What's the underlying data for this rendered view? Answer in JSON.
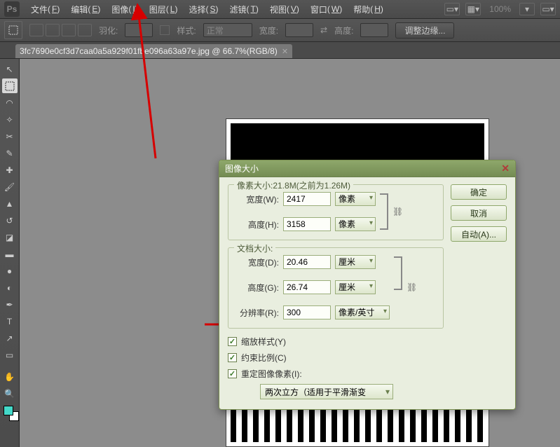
{
  "menu": {
    "items": [
      {
        "label": "文件",
        "key": "F"
      },
      {
        "label": "编辑",
        "key": "E"
      },
      {
        "label": "图像",
        "key": "I"
      },
      {
        "label": "图层",
        "key": "L"
      },
      {
        "label": "选择",
        "key": "S"
      },
      {
        "label": "滤镜",
        "key": "T"
      },
      {
        "label": "视图",
        "key": "V"
      },
      {
        "label": "窗口",
        "key": "W"
      },
      {
        "label": "帮助",
        "key": "H"
      }
    ],
    "zoom": "100%"
  },
  "options": {
    "feather_label": "羽化:",
    "style_label": "样式:",
    "style_value": "正常",
    "width_label": "宽度:",
    "height_label": "高度:",
    "refine_edges": "调整边缘..."
  },
  "doc": {
    "title": "3fc7690e0cf3d7caa0a5a929f01fbe096a63a97e.jpg @ 66.7%(RGB/8)"
  },
  "dialog": {
    "title": "图像大小",
    "buttons": {
      "ok": "确定",
      "cancel": "取消",
      "auto": "自动(A)..."
    },
    "pixel_section": {
      "legend": "像素大小:21.8M(之前为1.26M)",
      "width_label": "宽度(W):",
      "width_value": "2417",
      "width_unit": "像素",
      "height_label": "高度(H):",
      "height_value": "3158",
      "height_unit": "像素"
    },
    "doc_section": {
      "legend": "文档大小:",
      "width_label": "宽度(D):",
      "width_value": "20.46",
      "width_unit": "厘米",
      "height_label": "高度(G):",
      "height_value": "26.74",
      "height_unit": "厘米",
      "res_label": "分辨率(R):",
      "res_value": "300",
      "res_unit": "像素/英寸"
    },
    "checks": {
      "scale": "缩放样式(Y)",
      "constrain": "约束比例(C)",
      "resample": "重定图像像素(I):"
    },
    "resample_method": "两次立方（适用于平滑渐变"
  }
}
